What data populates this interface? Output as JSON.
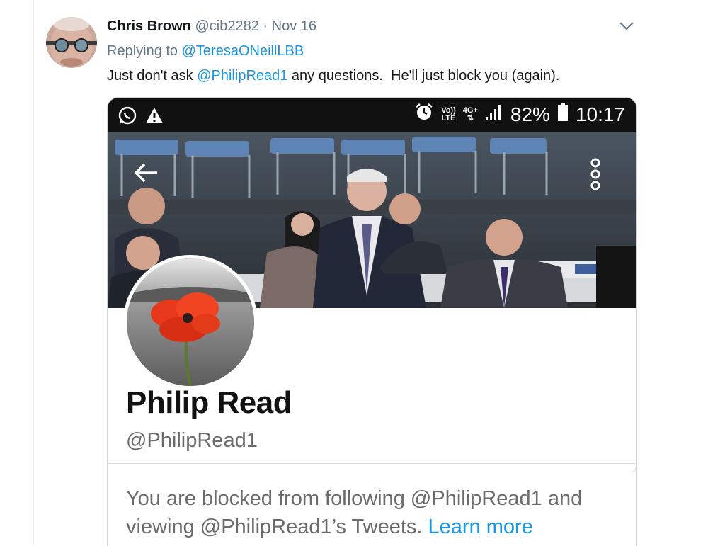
{
  "tweet": {
    "author_name": "Chris Brown",
    "author_handle": "@cib2282",
    "separator": "·",
    "date": "Nov 16",
    "replying_prefix": "Replying to",
    "replying_to": "@TeresaONeillLBB",
    "text_before": "Just don't ask ",
    "mention": "@PhilipRead1",
    "text_after": " any questions.  He'll just block you (again)."
  },
  "phone": {
    "status": {
      "volte_top": "Vo))",
      "volte_bottom": "LTE",
      "network": "4G+",
      "battery": "82%",
      "time": "10:17"
    },
    "profile": {
      "name": "Philip Read",
      "handle": "@PhilipRead1",
      "blocked_text": "You are blocked from following @PhilipRead1 and viewing @PhilipRead1’s Tweets.",
      "learn_more": "Learn more"
    }
  },
  "icons": [
    "avatar",
    "chevron-down-icon",
    "whatsapp-icon",
    "warning-icon",
    "alarm-icon",
    "signal-icon",
    "battery-icon",
    "back-arrow-icon",
    "more-options-icon",
    "poppy-profile-image"
  ],
  "colors": {
    "link": "#1b95e0",
    "muted": "#657786",
    "poppy": "#e8381c"
  }
}
